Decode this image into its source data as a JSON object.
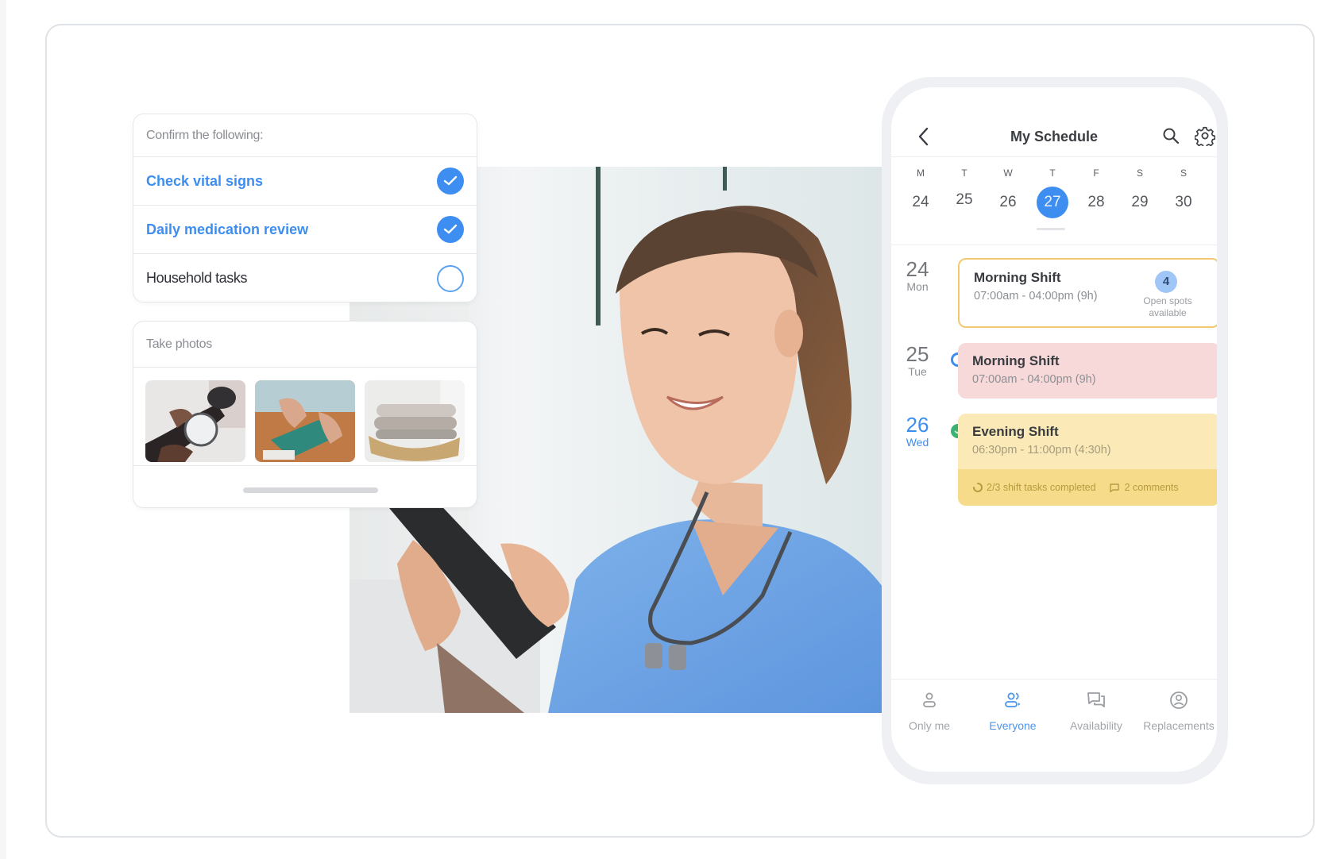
{
  "checklist": {
    "header": "Confirm the following:",
    "items": [
      {
        "label": "Check vital signs",
        "checked": true
      },
      {
        "label": "Daily medication review",
        "checked": true
      },
      {
        "label": "Household tasks",
        "checked": false
      }
    ]
  },
  "photos": {
    "header": "Take photos",
    "thumbnails": [
      {
        "subject": "blood pressure check"
      },
      {
        "subject": "pill organizer"
      },
      {
        "subject": "folded towels in basket"
      }
    ]
  },
  "schedule": {
    "title": "My Schedule",
    "icons": {
      "back": "chevron-left-icon",
      "search": "search-icon",
      "settings": "gear-icon"
    },
    "week": [
      {
        "dow": "M",
        "date": "24",
        "selected": false
      },
      {
        "dow": "T",
        "date": "25",
        "selected": false
      },
      {
        "dow": "W",
        "date": "26",
        "selected": false
      },
      {
        "dow": "T",
        "date": "27",
        "selected": true
      },
      {
        "dow": "F",
        "date": "28",
        "selected": false
      },
      {
        "dow": "S",
        "date": "29",
        "selected": false
      },
      {
        "dow": "S",
        "date": "30",
        "selected": false
      }
    ],
    "agenda": [
      {
        "day_num": "24",
        "day_name": "Mon",
        "shift_name": "Morning Shift",
        "shift_time": "07:00am - 04:00pm (9h)",
        "open_spots": "4",
        "open_spots_caption": "Open spots available"
      },
      {
        "day_num": "25",
        "day_name": "Tue",
        "status": "pending",
        "shift_name": "Morning Shift",
        "shift_time": "07:00am - 04:00pm (9h)"
      },
      {
        "day_num": "26",
        "day_name": "Wed",
        "status": "confirmed",
        "shift_name": "Evening Shift",
        "shift_time": "06:30pm - 11:00pm (4:30h)",
        "tasks_text": "2/3 shift tasks completed",
        "comments_text": "2 comments"
      }
    ],
    "tabs": [
      {
        "label": "Only me",
        "icon": "person-icon",
        "active": false
      },
      {
        "label": "Everyone",
        "icon": "people-icon",
        "active": true
      },
      {
        "label": "Availability",
        "icon": "chat-bubbles-icon",
        "active": false
      },
      {
        "label": "Replacements",
        "icon": "user-circle-icon",
        "active": false
      }
    ]
  },
  "colors": {
    "accent": "#3d8ef0",
    "open_shift_border": "#f3c970",
    "pending_shift": "#f7d9d9",
    "confirmed_shift": "#fbeab7",
    "confirmed_dot": "#3bb273"
  }
}
